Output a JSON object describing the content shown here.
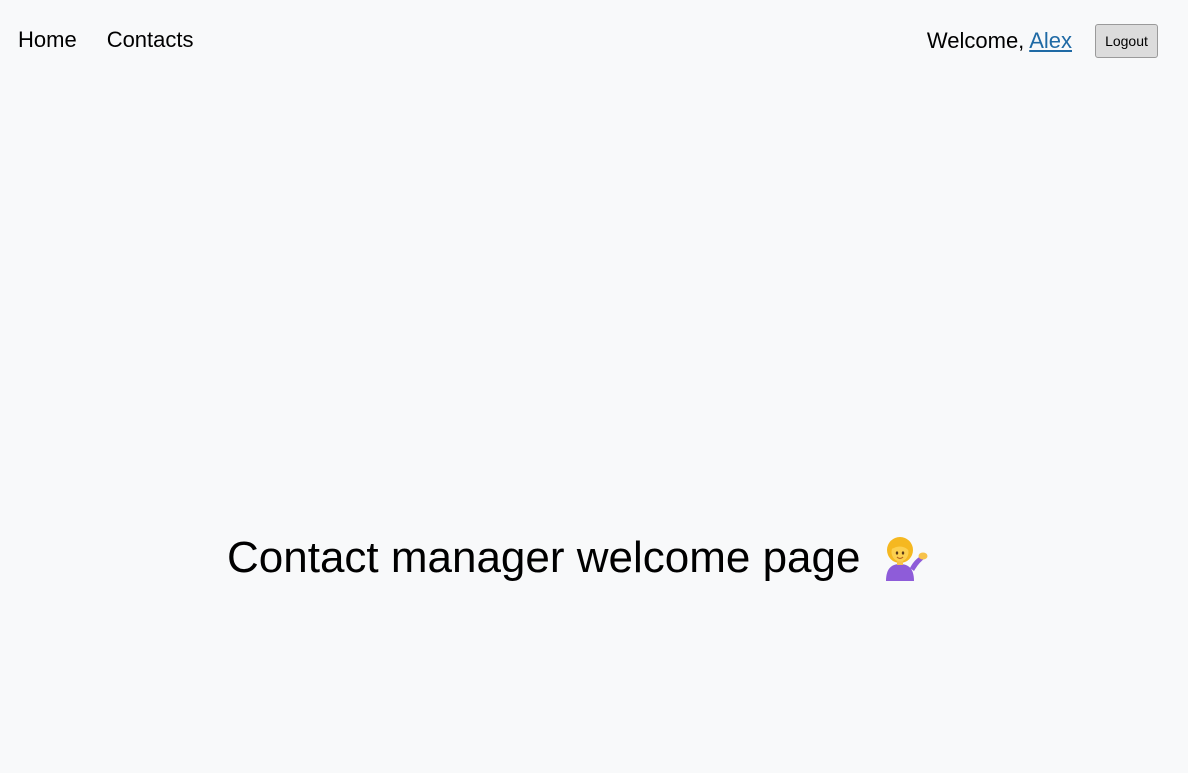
{
  "nav": {
    "home_label": "Home",
    "contacts_label": "Contacts"
  },
  "user": {
    "welcome_prefix": "Welcome, ",
    "name": "Alex",
    "logout_label": "Logout"
  },
  "main": {
    "title": "Contact manager welcome page",
    "title_icon": "woman-tipping-hand-icon"
  },
  "colors": {
    "background": "#f8f9fa",
    "link": "#1f6aa5",
    "button_bg": "#dcdcdc"
  }
}
